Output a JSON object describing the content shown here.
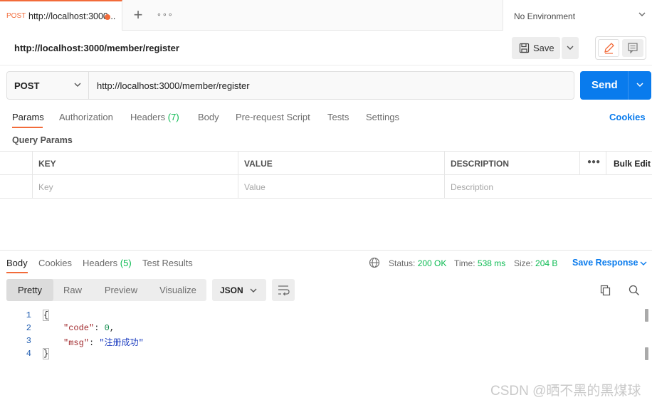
{
  "tab": {
    "method": "POST",
    "title": "http://localhost:3000...",
    "unsaved": true
  },
  "tab_actions": {
    "new_icon": "plus-icon",
    "more_icon": "more-icon"
  },
  "environment": {
    "label": "No Environment"
  },
  "request_title": "http://localhost:3000/member/register",
  "save": {
    "label": "Save"
  },
  "method": "POST",
  "url": "http://localhost:3000/member/register",
  "send": {
    "label": "Send"
  },
  "request_tabs": {
    "params": "Params",
    "authorization": "Authorization",
    "headers": "Headers",
    "headers_count": "(7)",
    "body": "Body",
    "prerequest": "Pre-request Script",
    "tests": "Tests",
    "settings": "Settings"
  },
  "cookies_link": "Cookies",
  "query_params_title": "Query Params",
  "params_table": {
    "headers": {
      "key": "KEY",
      "value": "VALUE",
      "description": "DESCRIPTION",
      "bulk_edit": "Bulk Edit"
    },
    "placeholders": {
      "key": "Key",
      "value": "Value",
      "description": "Description"
    }
  },
  "response_tabs": {
    "body": "Body",
    "cookies": "Cookies",
    "headers": "Headers",
    "headers_count": "(5)",
    "test_results": "Test Results"
  },
  "response_meta": {
    "status_label": "Status:",
    "status_value": "200 OK",
    "time_label": "Time:",
    "time_value": "538 ms",
    "size_label": "Size:",
    "size_value": "204 B",
    "save_response": "Save Response"
  },
  "format_tabs": {
    "pretty": "Pretty",
    "raw": "Raw",
    "preview": "Preview",
    "visualize": "Visualize"
  },
  "language": "JSON",
  "code_lines": {
    "l1": {
      "num": "1",
      "open": "{"
    },
    "l2": {
      "num": "2",
      "key": "\"code\"",
      "colon": ": ",
      "value": "0",
      "comma": ","
    },
    "l3": {
      "num": "3",
      "key": "\"msg\"",
      "colon": ": ",
      "value": "\"注册成功\""
    },
    "l4": {
      "num": "4",
      "close": "}"
    }
  },
  "watermark": "CSDN @晒不黑的黑煤球",
  "colors": {
    "accent": "#f26b3a",
    "send_blue": "#097bed",
    "success_green": "#0cbb52"
  }
}
